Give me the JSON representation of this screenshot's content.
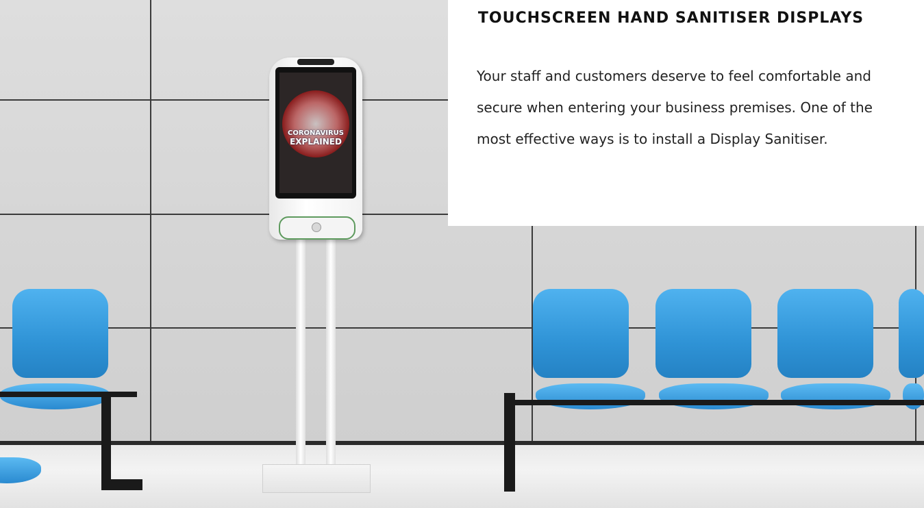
{
  "heading": "TOUCHSCREEN HAND SANITISER DISPLAYS",
  "body": "Your staff and customers deserve to feel comfortable and secure when entering your business premises. One of the most effective ways is to install a Display Sanitiser.",
  "screen": {
    "line1": "CORONAVIRUS",
    "line2": "EXPLAINED"
  },
  "colors": {
    "chair_blue": "#3aa3e4",
    "wall_grey": "#d6d6d6",
    "dispenser_green": "#5d9a5d"
  }
}
